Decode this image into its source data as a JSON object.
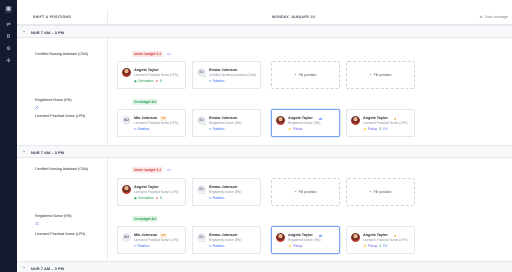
{
  "rail": {
    "items": [
      {
        "icon": "calendar-icon",
        "glyph": "▦",
        "active": true
      },
      {
        "icon": "sliders-icon",
        "glyph": "⇌",
        "active": false
      },
      {
        "icon": "bold-b-icon",
        "glyph": "B",
        "active": false
      },
      {
        "icon": "gear-icon",
        "glyph": "⚙",
        "active": false
      },
      {
        "icon": "users-icon",
        "glyph": "✣",
        "active": false
      }
    ]
  },
  "header": {
    "left_label": "SHIFT & POSITIONS",
    "date_label": "MONDAY, JANUARY 23",
    "right_label": "Total coverage"
  },
  "shifts": [
    {
      "label": "NUR 7 AM – 3 PM",
      "cna": {
        "role": "Certified Nursing Assistant (CNA)",
        "status": "Under budget 2.4",
        "cards": [
          {
            "name": "Angela Taylor",
            "subtitle": "Licensed Practical Nurse (LPN)",
            "tags": [
              "Orientation",
              "⊗",
              "$"
            ]
          },
          {
            "initials": "EJ",
            "name": "Emma Johnson",
            "subtitle": "Certified Nursing Assistant (CNA)",
            "tags": [
              "Rotation"
            ]
          }
        ],
        "fill_label": "Fill position"
      },
      "rn_lpn": {
        "role_rn": "Registered Nurse (RN)",
        "role_lpn": "Licensed Practical Nurse (LPN)",
        "status": "On budget 4/4",
        "cards": [
          {
            "initials": "MJ",
            "name": "Mia Johnson",
            "ot": "OT",
            "subtitle": "Licensed Practical Nurse (LPN)",
            "tags": [
              "Rotation"
            ]
          },
          {
            "initials": "EJ",
            "name": "Emma Johnson",
            "subtitle": "Registered Nurse (RN)",
            "tags": [
              "Rotation"
            ]
          },
          {
            "name": "Angela Taylor",
            "subtitle": "Registered Nurse (RN)",
            "tags": [
              "Pickup"
            ]
          },
          {
            "name": "Angela Taylor",
            "subtitle": "Licensed Practical Nurse (LPN)",
            "tags": [
              "Pickup",
              "$",
              "EX"
            ]
          }
        ]
      }
    },
    {
      "label": "NUR 7 AM – 3 PM",
      "cna": {
        "role": "Certified Nursing Assistant (CNA)",
        "status": "Under budget 2.4",
        "cards": [
          {
            "name": "Angela Taylor",
            "subtitle": "Licensed Practical Nurse (LPN)",
            "tags": [
              "Orientation",
              "⊗",
              "$"
            ]
          },
          {
            "initials": "EJ",
            "name": "Emma Johnson",
            "subtitle": "Registered Nurse (RN)",
            "tags": [
              "Rotation"
            ]
          }
        ],
        "fill_label": "Fill position"
      },
      "rn_lpn": {
        "role_rn": "Registered Nurse (RN)",
        "role_lpn": "Licensed Practical Nurse (LPN)",
        "status": "On budget 4/4",
        "cards": [
          {
            "initials": "MJ",
            "name": "Mia Johnson",
            "ot": "OT",
            "subtitle": "Licensed Practical Nurse (LPN)",
            "tags": [
              "Rotation"
            ]
          },
          {
            "initials": "EJ",
            "name": "Emma Johnson",
            "subtitle": "Registered Nurse (RN)",
            "tags": [
              "Rotation"
            ]
          },
          {
            "name": "Angela Taylor",
            "subtitle": "Registered Nurse (RN)",
            "tags": [
              "Pickup"
            ]
          },
          {
            "name": "Angela Taylor",
            "subtitle": "Licensed Practical Nurse (LPN)",
            "tags": [
              "Pickup",
              "$",
              "EX"
            ]
          }
        ]
      }
    },
    {
      "label": "NUR 7 AM – 3 PM"
    }
  ],
  "colors": {
    "rail": "#161a2e",
    "accent": "#3b6ef5",
    "under": "#d83a3a",
    "ok": "#1e9c52"
  }
}
